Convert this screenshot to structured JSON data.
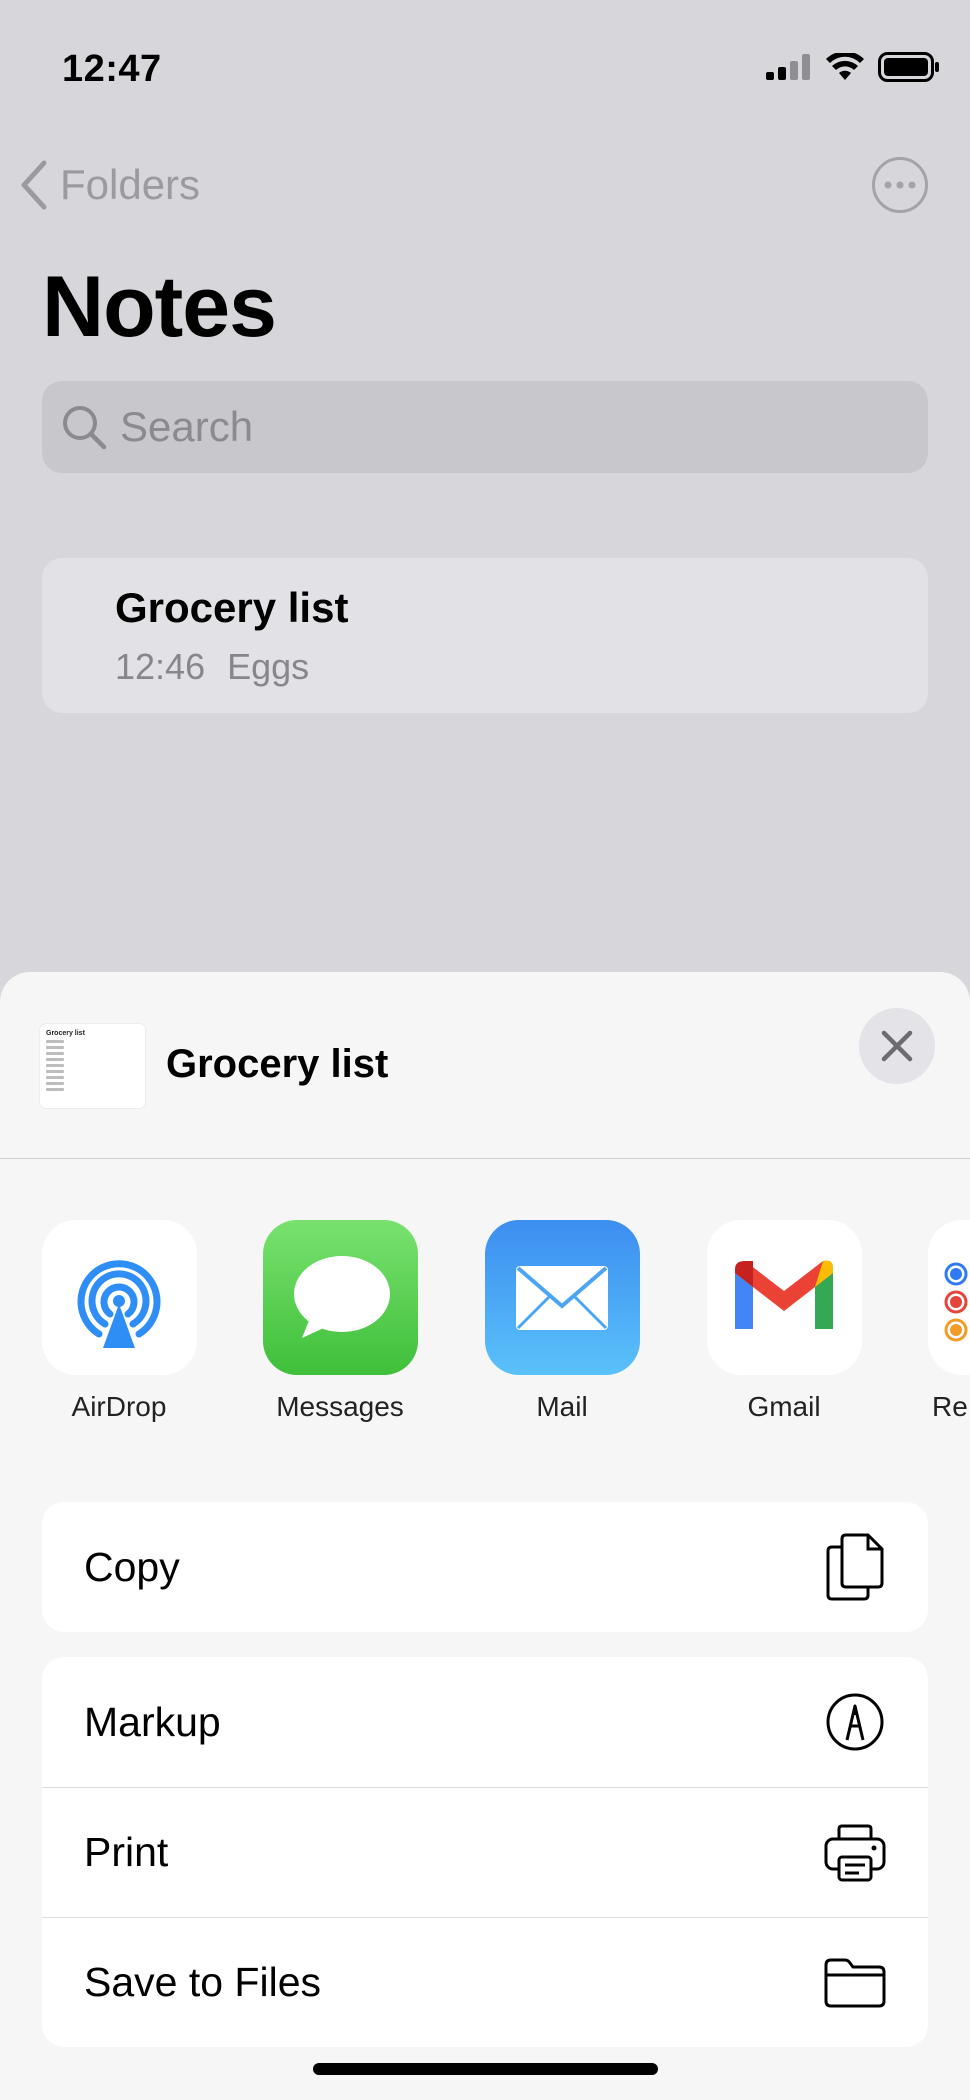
{
  "status_bar": {
    "time": "12:47"
  },
  "nav": {
    "back_label": "Folders"
  },
  "page": {
    "title": "Notes"
  },
  "search": {
    "placeholder": "Search"
  },
  "note": {
    "title": "Grocery list",
    "time": "12:46",
    "preview": "Eggs"
  },
  "share_sheet": {
    "title": "Grocery list",
    "thumbnail_title": "Grocery list",
    "apps": [
      {
        "label": "AirDrop",
        "icon": "airdrop-icon"
      },
      {
        "label": "Messages",
        "icon": "messages-icon"
      },
      {
        "label": "Mail",
        "icon": "mail-icon"
      },
      {
        "label": "Gmail",
        "icon": "gmail-icon"
      },
      {
        "label": "Re",
        "icon": "reminders-icon"
      }
    ],
    "actions_group1": [
      {
        "label": "Copy",
        "icon": "copy-icon"
      }
    ],
    "actions_group2": [
      {
        "label": "Markup",
        "icon": "markup-icon"
      },
      {
        "label": "Print",
        "icon": "print-icon"
      },
      {
        "label": "Save to Files",
        "icon": "folder-icon"
      }
    ]
  }
}
